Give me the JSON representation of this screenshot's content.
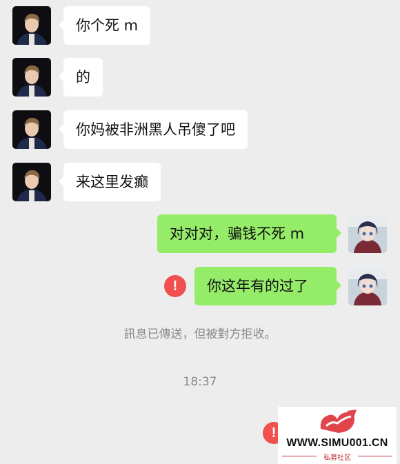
{
  "messages": [
    {
      "side": "in",
      "text": "你个死 m"
    },
    {
      "side": "in",
      "text": "的"
    },
    {
      "side": "in",
      "text": "你妈被非洲黑人吊傻了吧"
    },
    {
      "side": "in",
      "text": "来这里发癫"
    },
    {
      "side": "out",
      "text": "对对对，骗钱不死 m"
    },
    {
      "side": "out",
      "text": "你这年有的过了",
      "status": "failed"
    }
  ],
  "system_notice": "訊息已傳送，但被對方拒收。",
  "timestamp": "18:37",
  "error_icon_glyph": "!",
  "watermark": {
    "site": "WWW.SIMU001.CN",
    "subtitle": "私募社区",
    "logo_icon": "red-ribbon-logo"
  },
  "colors": {
    "background": "#ededed",
    "incoming_bubble": "#ffffff",
    "outgoing_bubble": "#95ec69",
    "error": "#f0504e",
    "system_text": "#8a8a8a"
  }
}
